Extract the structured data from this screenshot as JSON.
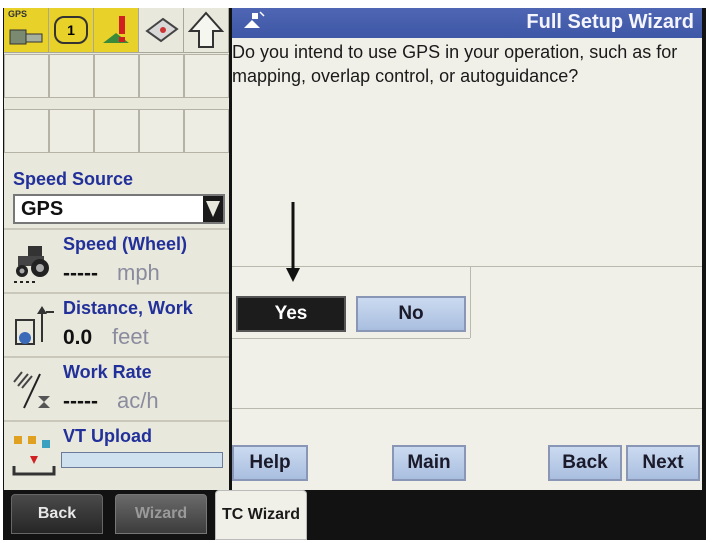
{
  "toolbar": {
    "icons": [
      "gps-receiver-icon",
      "implement-icon",
      "alarm-icon",
      "book-icon",
      "up-arrow-icon"
    ],
    "gps_label": "GPS",
    "implement_label": "1"
  },
  "left_panel": {
    "speed_source": {
      "label": "Speed Source",
      "value": "GPS"
    },
    "speed": {
      "title": "Speed (Wheel)",
      "value": "-----",
      "unit": "mph"
    },
    "distance": {
      "title": "Distance, Work",
      "value": "0.0",
      "unit": "feet"
    },
    "work_rate": {
      "title": "Work Rate",
      "value": "-----",
      "unit": "ac/h"
    },
    "vt_upload": {
      "title": "VT Upload",
      "progress": 0.0
    }
  },
  "wizard": {
    "title": "Full Setup Wizard",
    "question": "Do you intend to use GPS in your operation, such as for mapping, overlap control, or autoguidance?",
    "yes_label": "Yes",
    "no_label": "No"
  },
  "nav_buttons": {
    "help": "Help",
    "main": "Main",
    "back": "Back",
    "next": "Next"
  },
  "bottom_tabs": {
    "back": "Back",
    "wizard": "Wizard",
    "tc_wizard": "TC Wizard"
  },
  "colors": {
    "title_bar": "#4e66b3",
    "label_blue": "#22309a",
    "button_blue": "#b9cbe8",
    "selected": "#1c1c1c"
  }
}
